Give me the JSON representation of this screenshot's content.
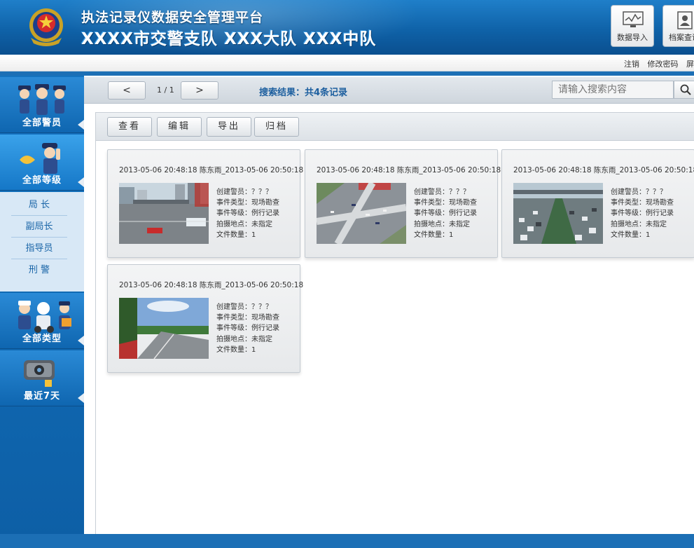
{
  "header": {
    "title": "执法记录仪数据安全管理平台",
    "subtitle": "XXXX市交警支队  XXX大队  XXX中队",
    "buttons": [
      {
        "label": "数据导入",
        "icon": "monitor-chart-icon"
      },
      {
        "label": "档案查询",
        "icon": "file-user-icon"
      }
    ]
  },
  "topbar": {
    "links": [
      "注销",
      "修改密码",
      "屏"
    ]
  },
  "sidebar": {
    "categories": [
      {
        "label": "全部警员",
        "icon": "police-officers-icon"
      },
      {
        "label": "全部等级",
        "icon": "police-salute-icon"
      },
      {
        "label": "全部类型",
        "icon": "traffic-police-icon"
      },
      {
        "label": "最近7天",
        "icon": "camera-recorder-icon"
      }
    ],
    "ranks": [
      "局  长",
      "副局长",
      "指导员",
      "刑  警"
    ]
  },
  "pager": {
    "prev": "<",
    "next": ">",
    "info": "1 / 1"
  },
  "search": {
    "result": "搜索结果：共4条记录",
    "placeholder": "请输入搜索内容"
  },
  "actions": [
    "查看",
    "编辑",
    "导出",
    "归档"
  ],
  "records": [
    {
      "title": "2013-05-06 20:48:18 陈东雨_2013-05-06 20:50:18",
      "creator": "创建警员：？？？",
      "type": "事件类型：现场勘查",
      "level": "事件等级：例行记录",
      "location": "拍摄地点：未指定",
      "files": "文件数量：1",
      "image": "city-intersection-photo"
    },
    {
      "title": "2013-05-06 20:48:18 陈东雨_2013-05-06 20:50:18",
      "creator": "创建警员：？？？",
      "type": "事件类型：现场勘查",
      "level": "事件等级：例行记录",
      "location": "拍摄地点：未指定",
      "files": "文件数量：1",
      "image": "aerial-crossroad-photo"
    },
    {
      "title": "2013-05-06 20:48:18 陈东雨_2013-05-06 20:50:18",
      "creator": "创建警员：？？？",
      "type": "事件类型：现场勘查",
      "level": "事件等级：例行记录",
      "location": "拍摄地点：未指定",
      "files": "文件数量：1",
      "image": "traffic-jam-photo"
    },
    {
      "title": "2013-05-06 20:48:18 陈东雨_2013-05-06 20:50:18",
      "creator": "创建警员：？？？",
      "type": "事件类型：现场勘查",
      "level": "事件等级：例行记录",
      "location": "拍摄地点：未指定",
      "files": "文件数量：1",
      "image": "tree-lined-road-photo"
    }
  ],
  "colors": {
    "brand": "#0f62a8",
    "accent": "#1d5f9f",
    "sidebar": "#1473bf"
  }
}
